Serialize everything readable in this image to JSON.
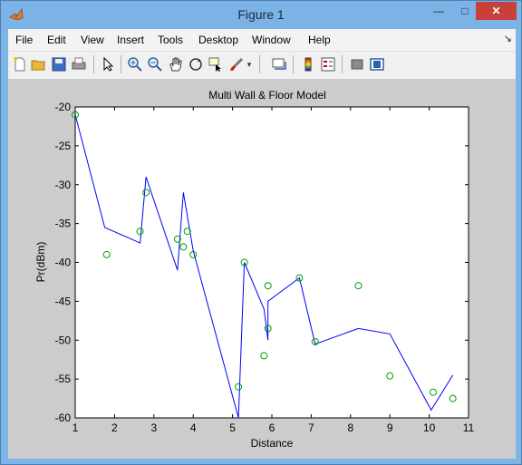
{
  "window": {
    "title": "Figure 1",
    "minimize_glyph": "—",
    "maximize_glyph": "□",
    "close_glyph": "✕"
  },
  "menu": {
    "items": [
      "File",
      "Edit",
      "View",
      "Insert",
      "Tools",
      "Desktop",
      "Window",
      "Help"
    ],
    "dock_glyph": "↘"
  },
  "toolbar": {
    "icons": [
      "new-figure-icon",
      "open-file-icon",
      "save-icon",
      "print-icon",
      "pointer-icon",
      "zoom-in-icon",
      "zoom-out-icon",
      "pan-icon",
      "rotate-3d-icon",
      "data-cursor-icon",
      "brush-icon",
      "brush-dropdown-icon",
      "link-plot-icon",
      "colorbar-icon",
      "legend-icon",
      "hide-plot-tools-icon",
      "show-plot-tools-icon"
    ]
  },
  "chart_data": {
    "type": "line",
    "title": "Multi Wall & Floor Model",
    "xlabel": "Distance",
    "ylabel": "Pr(dBm)",
    "xlim": [
      1,
      11
    ],
    "ylim": [
      -60,
      -20
    ],
    "xticks": [
      "1",
      "2",
      "3",
      "4",
      "5",
      "6",
      "7",
      "8",
      "9",
      "10",
      "11"
    ],
    "yticks": [
      "-20",
      "-25",
      "-30",
      "-35",
      "-40",
      "-45",
      "-50",
      "-55",
      "-60"
    ],
    "grid": false,
    "series": [
      {
        "style": "line",
        "color": "#0000ff",
        "x": [
          1.0,
          1.75,
          2.65,
          2.8,
          3.6,
          3.75,
          4.0,
          5.15,
          5.3,
          5.8,
          5.9,
          5.9,
          6.7,
          7.1,
          8.2,
          9.0,
          10.05,
          10.6
        ],
        "y": [
          -21.0,
          -35.5,
          -37.5,
          -29.0,
          -41.0,
          -31.0,
          -38.5,
          -60.0,
          -40.0,
          -46.0,
          -50.0,
          -45.0,
          -42.0,
          -50.5,
          -48.5,
          -49.2,
          -59.0,
          -54.5
        ]
      },
      {
        "style": "markers",
        "marker": "circle",
        "color": "#00a000",
        "x": [
          1.0,
          1.8,
          2.65,
          2.8,
          3.6,
          3.75,
          3.85,
          4.0,
          5.15,
          5.3,
          5.8,
          5.9,
          5.9,
          6.7,
          7.1,
          8.2,
          9.0,
          10.1,
          10.6
        ],
        "y": [
          -21.0,
          -39.0,
          -36.0,
          -31.0,
          -37.0,
          -38.0,
          -36.0,
          -39.0,
          -56.0,
          -40.0,
          -52.0,
          -43.0,
          -48.5,
          -42.0,
          -50.2,
          -43.0,
          -54.6,
          -56.7,
          -57.5
        ]
      }
    ]
  }
}
